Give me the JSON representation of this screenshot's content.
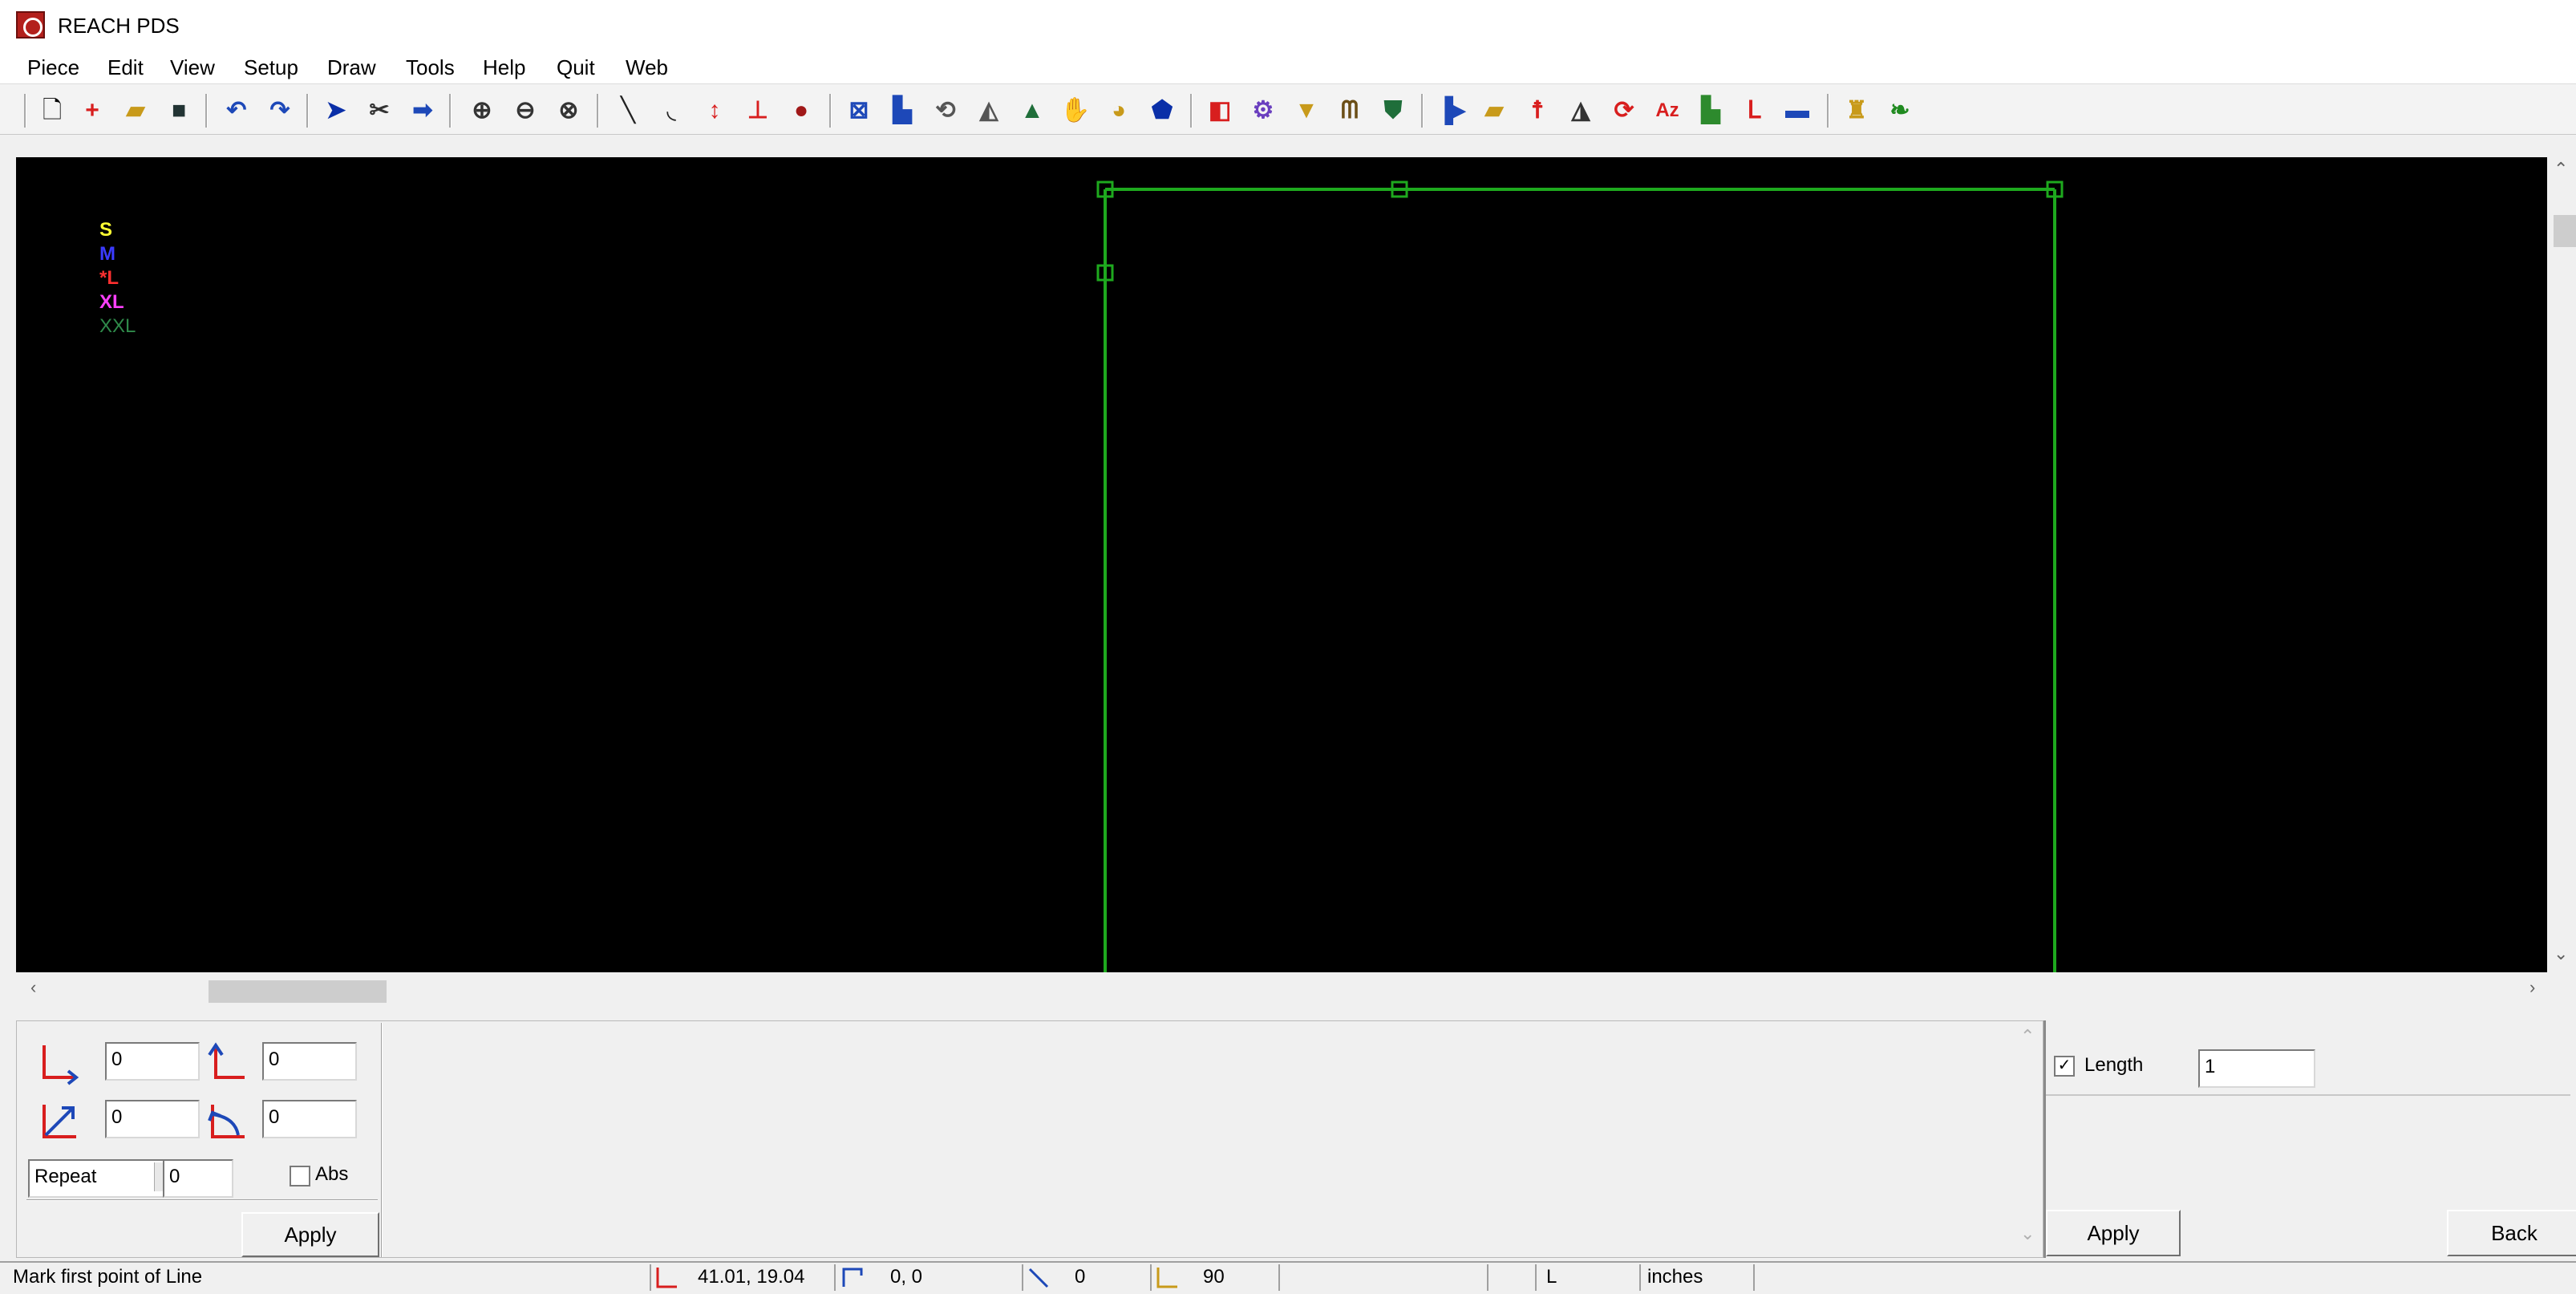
{
  "window": {
    "title": "REACH PDS"
  },
  "menu": [
    "Piece",
    "Edit",
    "View",
    "Setup",
    "Draw",
    "Tools",
    "Help",
    "Quit",
    "Web"
  ],
  "toolbar": {
    "icons": [
      "new-file-icon",
      "add-icon",
      "open-folder-icon",
      "save-icon",
      "undo-icon",
      "redo-icon",
      "select-arrow-icon",
      "cut-icon",
      "move-icon",
      "zoom-in-icon",
      "zoom-out-icon",
      "zoom-fit-icon",
      "line-icon",
      "curve-icon",
      "vertical-icon",
      "perpendicular-icon",
      "circle-icon",
      "notch-icon",
      "piece-icon",
      "rotate-icon",
      "triangle-icon",
      "mountain-icon",
      "grab-icon",
      "grade-icon",
      "fill-icon",
      "pattern-icon",
      "gear-icon",
      "cone-icon",
      "comb-icon",
      "shield-icon",
      "walk-icon",
      "open-icon",
      "figure-icon",
      "mirror-icon",
      "reset-icon",
      "text-icon",
      "boot-icon",
      "sock-icon",
      "monitor-icon",
      "trophy-icon",
      "plant-icon"
    ]
  },
  "sizes": [
    {
      "label": "S",
      "color": "#ffff33"
    },
    {
      "label": "M",
      "color": "#3b3bff"
    },
    {
      "label": "*L",
      "color": "#ff3030"
    },
    {
      "label": "XL",
      "color": "#ff40ff"
    },
    {
      "label": "XXL",
      "color": "#2f8a4a"
    }
  ],
  "drawing": {
    "line_color": "#1ea91e"
  },
  "input_panel": {
    "fields": [
      "0",
      "0",
      "0",
      "0"
    ],
    "repeat_label": "Repeat",
    "repeat_value": "0",
    "abs_label": "Abs",
    "apply_label": "Apply"
  },
  "right_panel": {
    "length_label": "Length",
    "length_checked": true,
    "length_value": "1",
    "apply_label": "Apply",
    "back_label": "Back"
  },
  "status": {
    "message": "Mark first point of Line",
    "coords": "41.01,  19.04",
    "offset": "0, 0",
    "angle": "0",
    "angle2": "90",
    "size": "L",
    "units": "inches"
  }
}
